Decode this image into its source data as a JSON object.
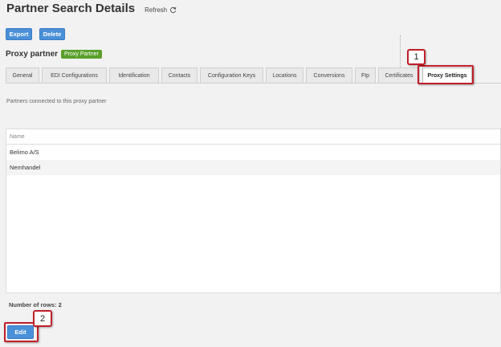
{
  "header": {
    "title": "Partner Search Details",
    "refresh_label": "Refresh"
  },
  "toolbar": {
    "export_label": "Export",
    "delete_label": "Delete"
  },
  "subheader": {
    "title": "Proxy partner",
    "badge": "Proxy Partner"
  },
  "tabs": [
    {
      "label": "General"
    },
    {
      "label": "EDI Configurations"
    },
    {
      "label": "Identification"
    },
    {
      "label": "Contacts"
    },
    {
      "label": "Configuration Keys"
    },
    {
      "label": "Locations"
    },
    {
      "label": "Conversions"
    },
    {
      "label": "Ftp"
    },
    {
      "label": "Certificates"
    },
    {
      "label": "Proxy Settings",
      "active": true
    }
  ],
  "main": {
    "description": "Partners connected to this proxy partner",
    "grid": {
      "columns": [
        "Name"
      ],
      "rows": [
        [
          "Belimo A/S"
        ],
        [
          "Nemhandel"
        ]
      ]
    },
    "row_count": "Number of rows: 2",
    "edit_label": "Edit"
  },
  "annotations": {
    "callout_1": "1",
    "callout_2": "2"
  },
  "colors": {
    "primary_button": "#4a90d9",
    "badge_green": "#5aa02c",
    "callout_red": "#c0202a"
  },
  "icons": {
    "refresh": "refresh-icon"
  }
}
